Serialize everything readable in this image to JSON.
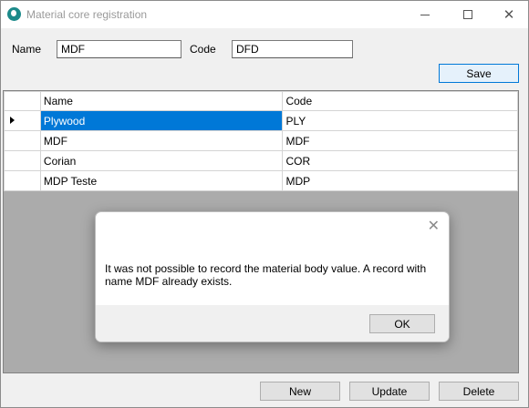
{
  "window": {
    "title": "Material core registration",
    "accent_color": "#0078d7"
  },
  "form": {
    "name_label": "Name",
    "name_value": "MDF",
    "code_label": "Code",
    "code_value": "DFD",
    "save_label": "Save"
  },
  "grid": {
    "columns": [
      "Name",
      "Code"
    ],
    "selected_row": 0,
    "rows": [
      {
        "name": "Plywood",
        "code": "PLY"
      },
      {
        "name": "MDF",
        "code": "MDF"
      },
      {
        "name": "Corian",
        "code": "COR"
      },
      {
        "name": "MDP Teste",
        "code": "MDP"
      }
    ]
  },
  "dialog": {
    "message": "It was not possible to record the material body value. A record with name MDF already exists.",
    "ok_label": "OK"
  },
  "actions": {
    "new_label": "New",
    "update_label": "Update",
    "delete_label": "Delete"
  }
}
